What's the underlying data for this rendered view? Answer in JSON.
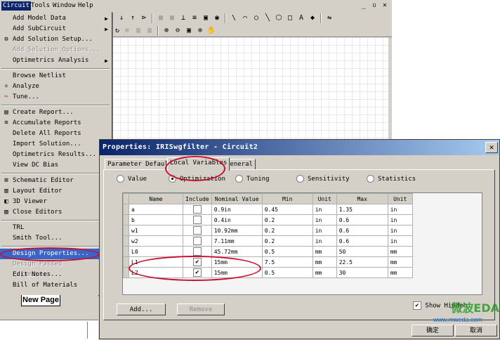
{
  "menubar": {
    "items": [
      {
        "label": "Circuit"
      },
      {
        "label": "Tools"
      },
      {
        "label": "Window"
      },
      {
        "label": "Help"
      }
    ],
    "window_buttons": [
      "_",
      "▫",
      "✕"
    ]
  },
  "menu": {
    "items": [
      {
        "label": "Add Model Data",
        "icon": "",
        "submenu": true,
        "disabled": false
      },
      {
        "label": "Add SubCircuit",
        "icon": "",
        "submenu": true,
        "disabled": false
      },
      {
        "label": "Add Solution Setup...",
        "icon": "solution-setup-icon",
        "disabled": false
      },
      {
        "label": "Add Solution Options...",
        "icon": "",
        "disabled": true
      },
      {
        "label": "Optimetrics Analysis",
        "icon": "",
        "submenu": true,
        "disabled": false
      },
      {
        "label": "Browse Netlist",
        "icon": "",
        "disabled": false
      },
      {
        "label": "Analyze",
        "icon": "analyze-icon",
        "disabled": false
      },
      {
        "label": "Tune...",
        "icon": "tune-icon",
        "disabled": false
      },
      {
        "label": "Create Report...",
        "icon": "report-icon",
        "disabled": false
      },
      {
        "label": "Accumulate Reports",
        "icon": "accumulate-icon",
        "disabled": false
      },
      {
        "label": "Delete All Reports",
        "icon": "",
        "disabled": false
      },
      {
        "label": "Import Solution...",
        "icon": "",
        "disabled": false
      },
      {
        "label": "Optimetrics Results...",
        "icon": "",
        "disabled": false
      },
      {
        "label": "View DC Bias",
        "icon": "",
        "disabled": false
      },
      {
        "label": "Schematic Editor",
        "icon": "schematic-icon",
        "disabled": false
      },
      {
        "label": "Layout Editor",
        "icon": "layout-icon",
        "disabled": false
      },
      {
        "label": "3D Viewer",
        "icon": "3d-viewer-icon",
        "disabled": false
      },
      {
        "label": "Close Editors",
        "icon": "close-editors-icon",
        "disabled": false
      },
      {
        "label": "TRL",
        "icon": "",
        "disabled": false
      },
      {
        "label": "Smith Tool...",
        "icon": "",
        "disabled": false
      },
      {
        "label": "Design Properties...",
        "icon": "",
        "disabled": false,
        "highlighted": true
      },
      {
        "label": "Design Passed Parameters...",
        "icon": "",
        "disabled": true
      },
      {
        "label": "Edit Notes...",
        "icon": "",
        "disabled": false
      },
      {
        "label": "Bill of Materials",
        "icon": "",
        "disabled": false
      }
    ]
  },
  "bottom": {
    "new_page_tab": "New Page"
  },
  "dialog": {
    "title": "Properties: IRISwgfilter - Circuit2",
    "tabs": [
      {
        "label": "Parameter Defaults"
      },
      {
        "label": "Local Variables",
        "selected": true
      },
      {
        "label": "General"
      }
    ],
    "radio_options": [
      {
        "label": "Value",
        "checked": false
      },
      {
        "label": "Optimization",
        "checked": true
      },
      {
        "label": "Tuning",
        "checked": false
      },
      {
        "label": "Sensitivity",
        "checked": false
      },
      {
        "label": "Statistics",
        "checked": false
      }
    ],
    "table": {
      "columns": [
        "Name",
        "Include",
        "Nominal Value",
        "Min",
        "Unit",
        "Max",
        "Unit"
      ],
      "rows": [
        {
          "name": "a",
          "include": false,
          "nominal": "0.9in",
          "min": "0.45",
          "min_unit": "in",
          "max": "1.35",
          "max_unit": "in"
        },
        {
          "name": "b",
          "include": false,
          "nominal": "0.4in",
          "min": "0.2",
          "min_unit": "in",
          "max": "0.6",
          "max_unit": "in"
        },
        {
          "name": "w1",
          "include": false,
          "nominal": "10.92mm",
          "min": "0.2",
          "min_unit": "in",
          "max": "0.6",
          "max_unit": "in"
        },
        {
          "name": "w2",
          "include": false,
          "nominal": "7.11mm",
          "min": "0.2",
          "min_unit": "in",
          "max": "0.6",
          "max_unit": "in"
        },
        {
          "name": "L0",
          "include": false,
          "nominal": "45.72mm",
          "min": "0.5",
          "min_unit": "mm",
          "max": "50",
          "max_unit": "mm"
        },
        {
          "name": "L1",
          "include": true,
          "nominal": "15mm",
          "min": "7.5",
          "min_unit": "mm",
          "max": "22.5",
          "max_unit": "mm"
        },
        {
          "name": "L2",
          "include": true,
          "nominal": "15mm",
          "min": "0.5",
          "min_unit": "mm",
          "max": "30",
          "max_unit": "mm"
        }
      ]
    },
    "add_button": "Add...",
    "remove_button": "Remove",
    "show_hidden": {
      "label": "Show Hidden",
      "checked": true
    },
    "ok_button": "确定",
    "cancel_button": "取消"
  },
  "watermark": {
    "brand": "微波EDA",
    "url": "www.mweda.com"
  },
  "colors": {
    "face": "#d4d0c8",
    "title_start": "#0a246a",
    "title_end": "#a6caf0",
    "highlight": "#3a64c6",
    "annotation": "#c8102e"
  }
}
